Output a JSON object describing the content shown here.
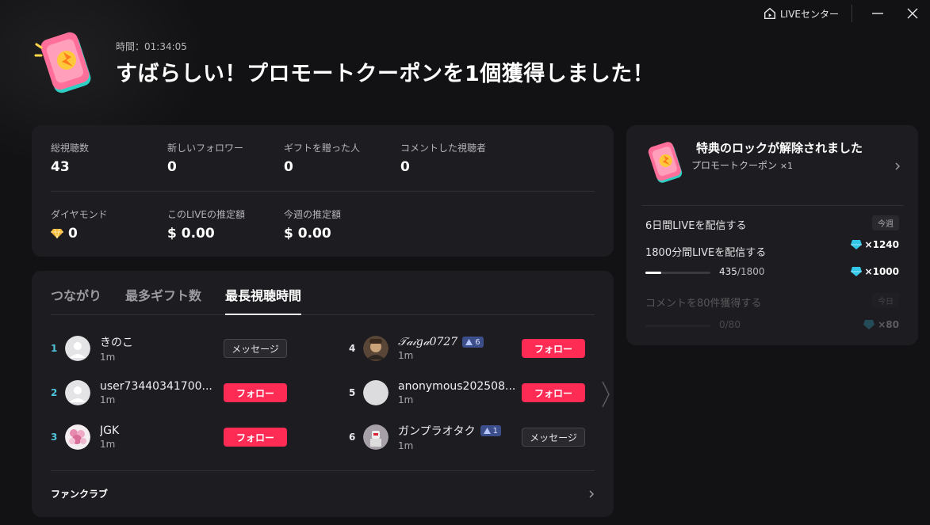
{
  "topbar": {
    "live_center": "LIVEセンター"
  },
  "header": {
    "time": "時間：01:34:05",
    "headline": "すばらしい！プロモートクーポンを1個獲得しました！"
  },
  "stats": [
    {
      "label": "総視聴数",
      "value": "43"
    },
    {
      "label": "新しいフォロワー",
      "value": "0"
    },
    {
      "label": "ギフトを贈った人",
      "value": "0"
    },
    {
      "label": "コメントした視聴者",
      "value": "0"
    },
    {
      "label": "ダイヤモンド",
      "value": "0",
      "icon": "diamond-icon"
    },
    {
      "label": "このLIVEの推定額",
      "value": "$ 0.00"
    },
    {
      "label": "今週の推定額",
      "value": "$ 0.00"
    }
  ],
  "tabs": [
    "つながり",
    "最多ギフト数",
    "最長視聴時間"
  ],
  "viewers": [
    {
      "rank": "1",
      "name": "きのこ",
      "time": "1m",
      "action": "メッセージ",
      "type": "message",
      "avatar": "default"
    },
    {
      "rank": "2",
      "name": "user73440341700...",
      "time": "1m",
      "action": "フォロー",
      "type": "follow",
      "avatar": "default"
    },
    {
      "rank": "3",
      "name": "JGK",
      "time": "1m",
      "action": "フォロー",
      "type": "follow",
      "avatar": "flowers"
    },
    {
      "rank": "4",
      "name": "𝒯𝒶𝒾𝑔𝒶0727",
      "badge": "6",
      "time": "1m",
      "action": "フォロー",
      "type": "follow",
      "avatar": "photo"
    },
    {
      "rank": "5",
      "name": "anonymous202508...",
      "time": "1m",
      "action": "フォロー",
      "type": "follow",
      "avatar": "plain"
    },
    {
      "rank": "6",
      "name": "ガンプラオタク",
      "badge": "1",
      "time": "1m",
      "action": "メッセージ",
      "type": "message",
      "avatar": "figure"
    }
  ],
  "fanclub": "ファンクラブ",
  "rewards": {
    "title": "特典のロックが解除されました",
    "subtitle": "プロモートクーポン",
    "subtitle_count": "×1",
    "missions": [
      {
        "label": "6日間LIVEを配信する",
        "tag": "今週",
        "reward": "×1240"
      },
      {
        "label": "1800分間LIVEを配信する",
        "tag": "今週",
        "progress": "435",
        "total": "/1800",
        "progress_fraction": 0.24,
        "reward": "×1000"
      },
      {
        "label": "コメントを80件獲得する",
        "tag": "今日",
        "progress": "0",
        "total": "/80",
        "progress_fraction": 0,
        "reward": "×80"
      }
    ]
  },
  "colors": {
    "follow": "#fe2c55",
    "rank": "#4fc3d9",
    "badge": "#3d4f8a"
  }
}
